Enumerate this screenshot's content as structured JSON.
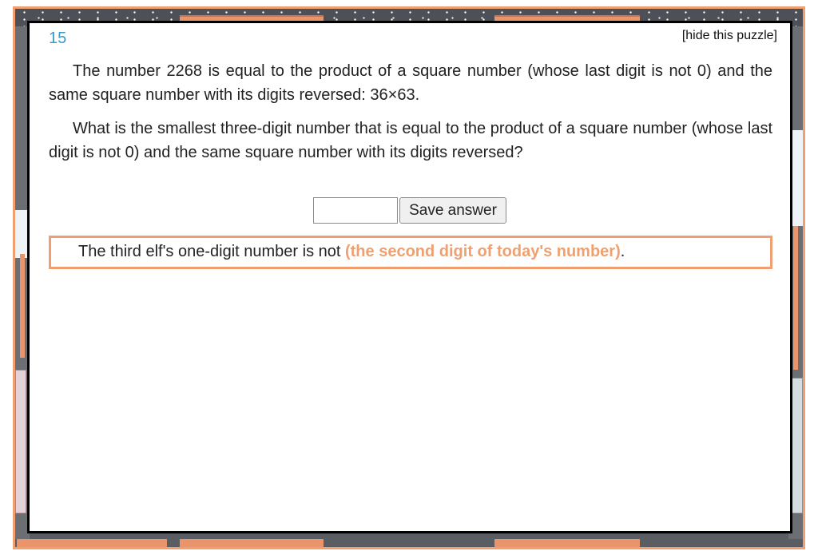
{
  "puzzle": {
    "day": "15",
    "hide_label": "[hide this puzzle]",
    "paragraphs": [
      "The number 2268 is equal to the product of a square number (whose last digit is not 0) and the same square number with its digits reversed: 36×63.",
      "What is the smallest three-digit number that is equal to the product of a square number (whose last digit is not 0) and the same square number with its digits reversed?"
    ]
  },
  "answer": {
    "input_value": "",
    "input_placeholder": "",
    "save_label": "Save answer"
  },
  "clue": {
    "prefix": "The third elf's one-digit number is not ",
    "highlight": "(the second digit of today's number)",
    "suffix": "."
  },
  "colors": {
    "frame_orange": "#f0a070",
    "day_number_blue": "#3a9ac6",
    "panel_border": "#000000"
  }
}
